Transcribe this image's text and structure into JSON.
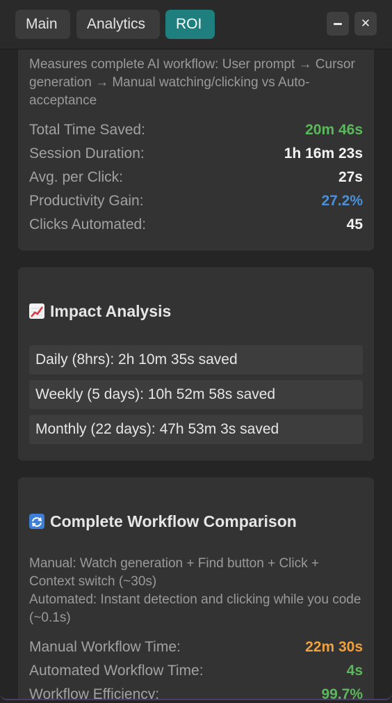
{
  "tabs": {
    "main": "Main",
    "analytics": "Analytics",
    "roi": "ROI"
  },
  "window_controls": {
    "close_glyph": "✕"
  },
  "roi_summary": {
    "description": "Measures complete AI workflow: User prompt → Cursor generation → Manual watching/clicking vs Auto-acceptance",
    "rows": [
      {
        "label": "Total Time Saved:",
        "value": "20m 46s",
        "color": "#5cb85c"
      },
      {
        "label": "Session Duration:",
        "value": "1h 16m 23s",
        "color": "#f4f4f4"
      },
      {
        "label": "Avg. per Click:",
        "value": "27s",
        "color": "#f4f4f4"
      },
      {
        "label": "Productivity Gain:",
        "value": "27.2%",
        "color": "#4a90d9"
      },
      {
        "label": "Clicks Automated:",
        "value": "45",
        "color": "#f4f4f4"
      }
    ]
  },
  "impact": {
    "icon": "chart-increasing-icon",
    "title": "Impact Analysis",
    "items": [
      "Daily (8hrs): 2h 10m 35s saved",
      "Weekly (5 days): 10h 52m 58s saved",
      "Monthly (22 days): 47h 53m 3s saved"
    ]
  },
  "comparison": {
    "icon": "sync-arrows-icon",
    "title": "Complete Workflow Comparison",
    "manual_desc": "Manual: Watch generation + Find button + Click + Context switch (~30s)",
    "auto_desc": "Automated: Instant detection and clicking while you code (~0.1s)",
    "rows": [
      {
        "label": "Manual Workflow Time:",
        "value": "22m 30s",
        "color": "#f0a03c"
      },
      {
        "label": "Automated Workflow Time:",
        "value": "4s",
        "color": "#5cb85c"
      },
      {
        "label": "Workflow Efficiency:",
        "value": "99.7%",
        "color": "#5cb85c"
      }
    ]
  },
  "colors": {
    "active_tab": "#1f7f7f",
    "card_bg": "#333333",
    "window_bg": "#252525"
  }
}
